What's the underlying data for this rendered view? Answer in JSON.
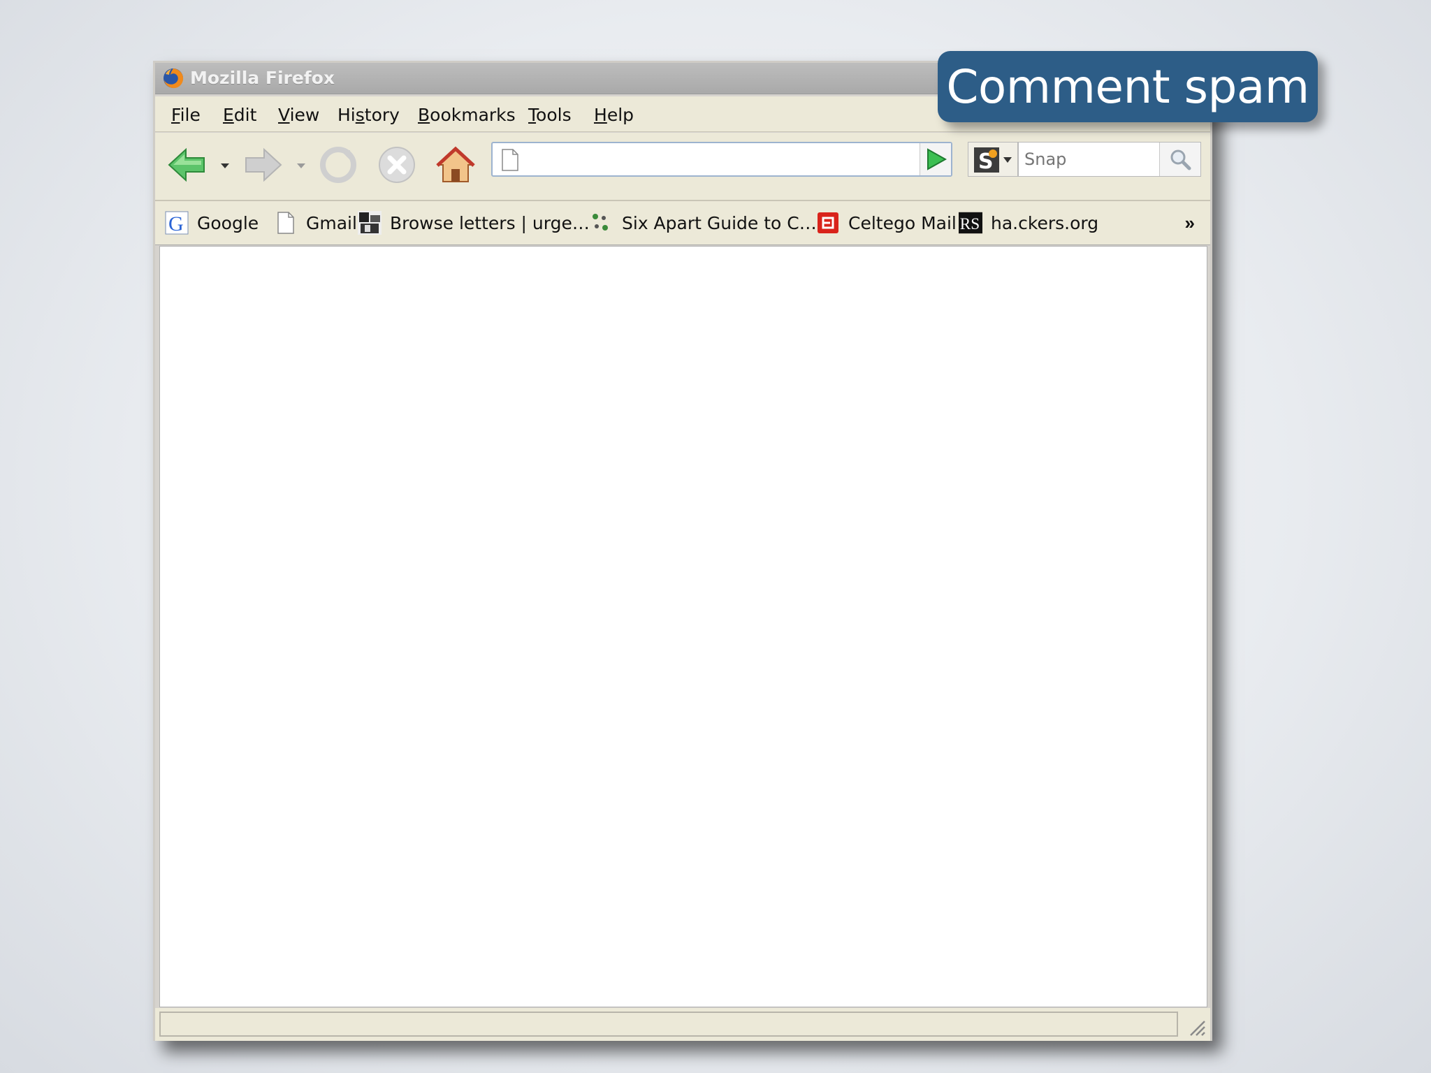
{
  "slide": {
    "badge_text": "Comment spam"
  },
  "window": {
    "title": "Mozilla Firefox"
  },
  "menu": {
    "items": [
      {
        "label": "File",
        "accel": "F"
      },
      {
        "label": "Edit",
        "accel": "E"
      },
      {
        "label": "View",
        "accel": "V"
      },
      {
        "label": "History",
        "accel": "s"
      },
      {
        "label": "Bookmarks",
        "accel": "B"
      },
      {
        "label": "Tools",
        "accel": "T"
      },
      {
        "label": "Help",
        "accel": "H"
      }
    ]
  },
  "navigation": {
    "url_value": "",
    "search_placeholder": "Snap",
    "icons": [
      "back-arrow-icon",
      "forward-arrow-icon",
      "reload-icon",
      "stop-icon",
      "home-icon",
      "go-arrow-icon",
      "magnifier-icon"
    ]
  },
  "bookmarks": {
    "items": [
      {
        "label": "Google",
        "icon": "google-g-icon"
      },
      {
        "label": "Gmail",
        "icon": "blank-page-icon"
      },
      {
        "label": "Browse letters | urge…",
        "icon": "thumbnail-icon"
      },
      {
        "label": "Six Apart Guide to C…",
        "icon": "dots-icon"
      },
      {
        "label": "Celtego Mail",
        "icon": "red-mail-icon"
      },
      {
        "label": "ha.ckers.org",
        "icon": "rs-icon"
      }
    ],
    "overflow": "»"
  },
  "status": {
    "text": ""
  },
  "colors": {
    "badge": "#2d5d87",
    "chrome": "#ece9d8",
    "titlebar": "#b3b3b3"
  }
}
